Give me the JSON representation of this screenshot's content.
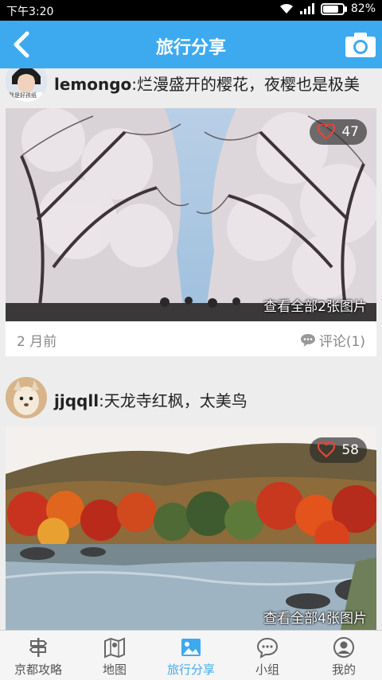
{
  "status_bar": {
    "time": "下午3:20",
    "battery": "82%",
    "battery_level": 0.82
  },
  "header": {
    "title": "旅行分享",
    "back_icon": "back-arrow-icon",
    "camera_icon": "camera-icon"
  },
  "posts": [
    {
      "username": "lemongo",
      "caption": ":烂漫盛开的樱花，夜樱也是极美",
      "avatar_caption": "我是好孩纸",
      "likes": "47",
      "view_all": "查看全部2张图片",
      "time_ago": "2 月前",
      "comments": "评论(1)"
    },
    {
      "username": "jjqqll",
      "caption": ":天龙寺红枫，太美鸟",
      "likes": "58",
      "view_all": "查看全部4张图片"
    }
  ],
  "tabs": [
    {
      "label": "京都攻略",
      "icon": "signpost-icon",
      "active": false
    },
    {
      "label": "地图",
      "icon": "map-icon",
      "active": false
    },
    {
      "label": "旅行分享",
      "icon": "photo-icon",
      "active": true
    },
    {
      "label": "小组",
      "icon": "chat-bubble-icon",
      "active": false
    },
    {
      "label": "我的",
      "icon": "person-icon",
      "active": false
    }
  ],
  "colors": {
    "accent": "#3daaf0",
    "like_heart": "#e8443a"
  }
}
